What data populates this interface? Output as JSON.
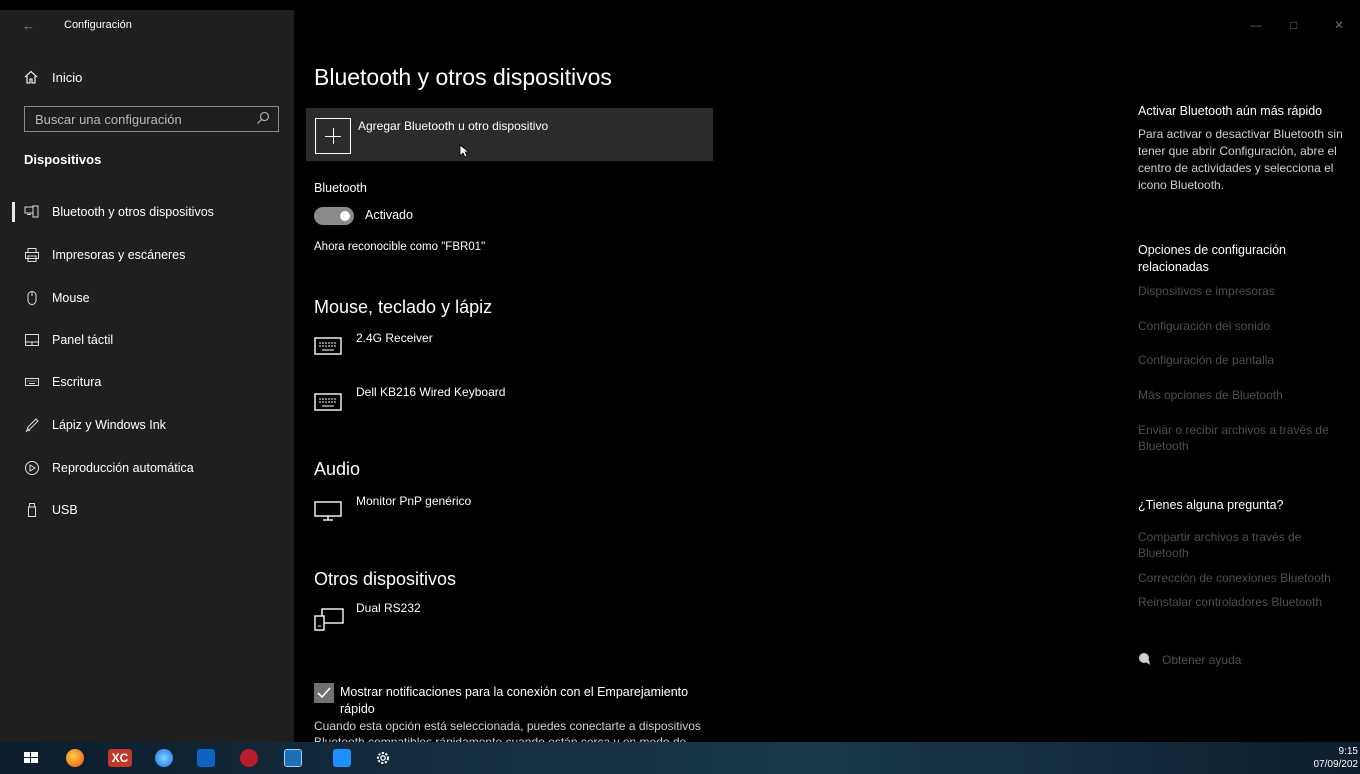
{
  "window": {
    "title": "Configuración"
  },
  "sidebar": {
    "home_label": "Inicio",
    "search_placeholder": "Buscar una configuración",
    "section_title": "Dispositivos",
    "items": [
      {
        "label": "Bluetooth y otros dispositivos",
        "icon": "bluetooth-devices-icon",
        "active": true
      },
      {
        "label": "Impresoras y escáneres",
        "icon": "printer-icon"
      },
      {
        "label": "Mouse",
        "icon": "mouse-icon"
      },
      {
        "label": "Panel táctil",
        "icon": "touchpad-icon"
      },
      {
        "label": "Escritura",
        "icon": "keyboard-icon"
      },
      {
        "label": "Lápiz y Windows Ink",
        "icon": "pen-icon"
      },
      {
        "label": "Reproducción automática",
        "icon": "autoplay-icon"
      },
      {
        "label": "USB",
        "icon": "usb-icon"
      }
    ]
  },
  "main": {
    "title": "Bluetooth y otros dispositivos",
    "add_device_label": "Agregar Bluetooth u otro dispositivo",
    "bluetooth_label": "Bluetooth",
    "bluetooth_toggle_label": "Activado",
    "bluetooth_on": true,
    "discoverable_text": "Ahora reconocible como \"FBR01\"",
    "groups": [
      {
        "title": "Mouse, teclado y lápiz",
        "devices": [
          {
            "name": "2.4G Receiver",
            "icon": "keyboard-icon"
          },
          {
            "name": "Dell KB216 Wired Keyboard",
            "icon": "keyboard-icon"
          }
        ]
      },
      {
        "title": "Audio",
        "devices": [
          {
            "name": "Monitor PnP genérico",
            "icon": "monitor-icon"
          }
        ]
      },
      {
        "title": "Otros dispositivos",
        "devices": [
          {
            "name": "Dual RS232",
            "icon": "device-icon"
          }
        ]
      }
    ],
    "swift_pair_label": "Mostrar notificaciones para la conexión con el Emparejamiento rápido",
    "swift_pair_checked": true,
    "swift_pair_description": "Cuando esta opción está seleccionada, puedes conectarte a dispositivos Bluetooth compatibles rápidamente cuando están cerca y en modo de"
  },
  "right_panel": {
    "tip_title": "Activar Bluetooth aún más rápido",
    "tip_text": "Para activar o desactivar Bluetooth sin tener que abrir Configuración, abre el centro de actividades y selecciona el icono Bluetooth.",
    "related_title": "Opciones de configuración relacionadas",
    "related_links": [
      "Dispositivos e impresoras",
      "Configuración del sonido",
      "Configuración de pantalla",
      "Más opciones de Bluetooth",
      "Enviar o recibir archivos a través de Bluetooth"
    ],
    "questions_title": "¿Tienes alguna pregunta?",
    "question_links": [
      "Compartir archivos a través de Bluetooth",
      "Corrección de conexiones Bluetooth",
      "Reinstalar controladores Bluetooth"
    ],
    "help_label": "Obtener ayuda"
  },
  "taskbar": {
    "time": "9:15",
    "date": "07/09/202"
  },
  "colors": {
    "sidebar_bg": "#1f1f1f",
    "main_bg": "#000000",
    "add_button_bg": "#2b2b2b",
    "toggle_bg": "#8a8a8a",
    "disabled_link": "#4f4f4f"
  }
}
